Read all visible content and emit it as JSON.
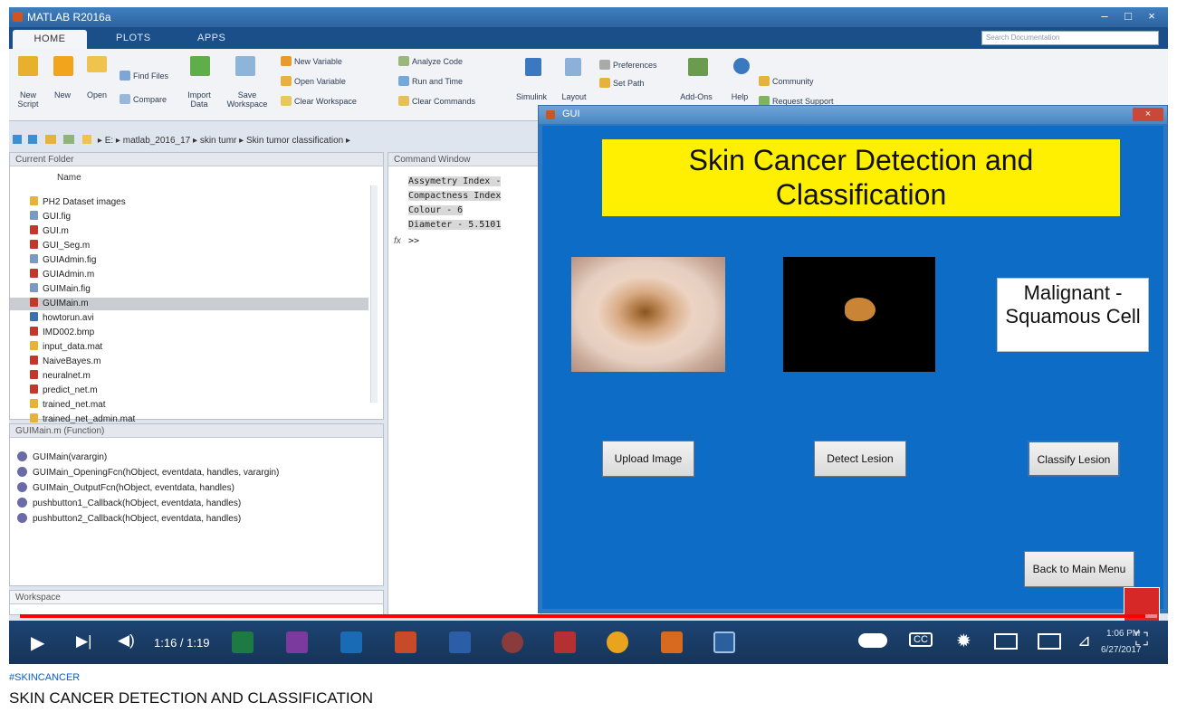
{
  "window": {
    "title": "MATLAB R2016a"
  },
  "ribbon_tabs": [
    "HOME",
    "PLOTS",
    "APPS"
  ],
  "search": {
    "placeholder": "Search Documentation"
  },
  "ribbon": {
    "new_script": "New Script",
    "new": "New",
    "open": "Open",
    "find_files": "Find Files",
    "compare": "Compare",
    "import_data": "Import Data",
    "save_workspace": "Save Workspace",
    "new_variable": "New Variable",
    "open_variable": "Open Variable",
    "clear_workspace": "Clear Workspace",
    "analyze_code": "Analyze Code",
    "run_and_time": "Run and Time",
    "clear_commands": "Clear Commands",
    "simulink": "Simulink",
    "layout": "Layout",
    "preferences": "Preferences",
    "set_path": "Set Path",
    "add_ons": "Add-Ons",
    "help": "Help",
    "community": "Community",
    "request_support": "Request Support"
  },
  "address": {
    "path": [
      "E:",
      "matlab_2016_17",
      "skin tumr",
      "Skin tumor classification"
    ]
  },
  "current_folder": {
    "title": "Current Folder",
    "column": "Name",
    "files": [
      "PH2 Dataset images",
      "GUI.fig",
      "GUI.m",
      "GUI_Seg.m",
      "GUIAdmin.fig",
      "GUIAdmin.m",
      "GUIMain.fig",
      "GUIMain.m",
      "howtorun.avi",
      "IMD002.bmp",
      "input_data.mat",
      "NaiveBayes.m",
      "neuralnet.m",
      "predict_net.m",
      "trained_net.mat",
      "trained_net_admin.mat"
    ]
  },
  "details": {
    "title": "GUIMain.m (Function)",
    "items": [
      "GUIMain(varargin)",
      "GUIMain_OpeningFcn(hObject, eventdata, handles, varargin)",
      "GUIMain_OutputFcn(hObject, eventdata, handles)",
      "pushbutton1_Callback(hObject, eventdata, handles)",
      "pushbutton2_Callback(hObject, eventdata, handles)"
    ]
  },
  "workspace": {
    "title": "Workspace"
  },
  "command_window": {
    "title": "Command Window",
    "lines": [
      "Assymetry Index -",
      "Compactness Index",
      "Colour - 6",
      "Diameter - 5.5101"
    ],
    "prompt": ">>"
  },
  "gui": {
    "title": "GUI",
    "banner": "Skin Cancer Detection and Classification",
    "result": "Malignant - Squamous Cell",
    "buttons": {
      "upload": "Upload Image",
      "detect": "Detect Lesion",
      "classify": "Classify Lesion",
      "back": "Back to Main Menu"
    }
  },
  "player": {
    "time": "1:16 / 1:19",
    "progress": 0.99,
    "cc": "CC"
  },
  "taskbar": {
    "clock_time": "1:06 PM",
    "clock_date": "6/27/2017"
  },
  "video_info": {
    "hashtag": "#SKINCANCER",
    "title": "SKIN CANCER DETECTION AND CLASSIFICATION"
  },
  "colors": {
    "matlab_blue": "#1a4f8a",
    "gui_bg": "#0d6cc6",
    "banner_yellow": "#ffef00",
    "progress_red": "#ff0000"
  }
}
